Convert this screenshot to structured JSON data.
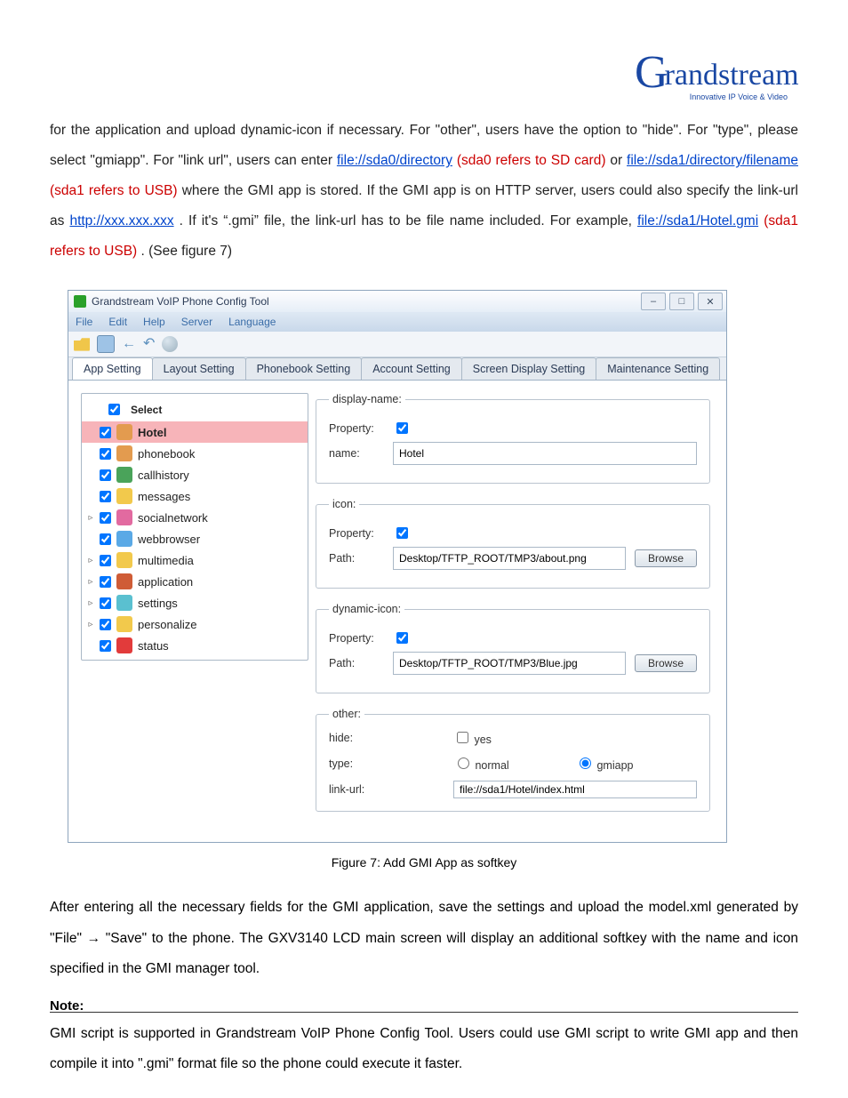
{
  "logo": {
    "brand_left": "G",
    "brand_right": "randstream",
    "tagline": "Innovative IP Voice & Video"
  },
  "paragraph1_parts": {
    "t1": "for the application and upload dynamic-icon if necessary. For \"other\", users have the option to \"hide\". For \"type\", please select \"gmiapp\". For \"link url\", users can enter ",
    "link1_text": "file://sda0/directory",
    "link1_red": " (sda0 refers to SD card)",
    "t2": " or ",
    "link2_text": "file://sda1/directory/filename",
    "link2_red": " (sda1 refers to USB)",
    "t3": " where the GMI app is stored. If the GMI app is on HTTP server, users could also specify the link-url as ",
    "link3_text": "http://xxx.xxx.xxx",
    "t4": ". If it's “.gmi” file, the link-url has to be file name included. For example, ",
    "link4_text": "file://sda1/Hotel.gmi",
    "link4_red": " (sda1 refers to USB)",
    "t5": ". (See figure 7)"
  },
  "figure_caption": "Figure 7: Add GMI App as softkey",
  "paragraph2": "After entering all the necessary fields for the GMI application, save the settings and upload the model.xml generated by \"File\" → \"Save\" to the phone. The GXV3140 LCD main screen will display an additional softkey with the name and icon specified in the GMI manager tool.",
  "note_title": "Note:",
  "note_body": "GMI script is supported in Grandstream VoIP Phone Config Tool. Users could use GMI script to write GMI app and then compile it into \".gmi\" format file so the phone could execute it faster.",
  "screenshot": {
    "title": "Grandstream VoIP Phone Config Tool",
    "window_buttons": {
      "min": "–",
      "max": "□",
      "close": "✕"
    },
    "menubar": [
      "File",
      "Edit",
      "Help",
      "Server",
      "Language"
    ],
    "tabs": [
      "App Setting",
      "Layout Setting",
      "Phonebook Setting",
      "Account Setting",
      "Screen Display Setting",
      "Maintenance Setting"
    ],
    "tree": {
      "header": "Select",
      "items": [
        {
          "exp": "",
          "label": "Hotel",
          "color": "#e39b4f",
          "selected": true
        },
        {
          "exp": "",
          "label": "phonebook",
          "color": "#e39b4f"
        },
        {
          "exp": "",
          "label": "callhistory",
          "color": "#4aa35a"
        },
        {
          "exp": "",
          "label": "messages",
          "color": "#f2c94c"
        },
        {
          "exp": "▹",
          "label": "socialnetwork",
          "color": "#e26aa0"
        },
        {
          "exp": "",
          "label": "webbrowser",
          "color": "#5aa9e6"
        },
        {
          "exp": "▹",
          "label": "multimedia",
          "color": "#f2c94c"
        },
        {
          "exp": "▹",
          "label": "application",
          "color": "#cf5c36"
        },
        {
          "exp": "▹",
          "label": "settings",
          "color": "#5ac0d0"
        },
        {
          "exp": "▹",
          "label": "personalize",
          "color": "#f2c94c"
        },
        {
          "exp": "",
          "label": "status",
          "color": "#e23b3b"
        }
      ]
    },
    "form": {
      "display_name": {
        "legend": "display-name:",
        "property": "Property:",
        "name_lbl": "name:",
        "name_val": "Hotel"
      },
      "icon": {
        "legend": "icon:",
        "property": "Property:",
        "path_lbl": "Path:",
        "path_val": "Desktop/TFTP_ROOT/TMP3/about.png",
        "browse": "Browse"
      },
      "dyn_icon": {
        "legend": "dynamic-icon:",
        "property": "Property:",
        "path_lbl": "Path:",
        "path_val": "Desktop/TFTP_ROOT/TMP3/Blue.jpg",
        "browse": "Browse"
      },
      "other": {
        "legend": "other:",
        "hide_lbl": "hide:",
        "hide_opt": "yes",
        "type_lbl": "type:",
        "type_normal": "normal",
        "type_gmi": "gmiapp",
        "link_lbl": "link-url:",
        "link_val": "file://sda1/Hotel/index.html"
      }
    }
  }
}
